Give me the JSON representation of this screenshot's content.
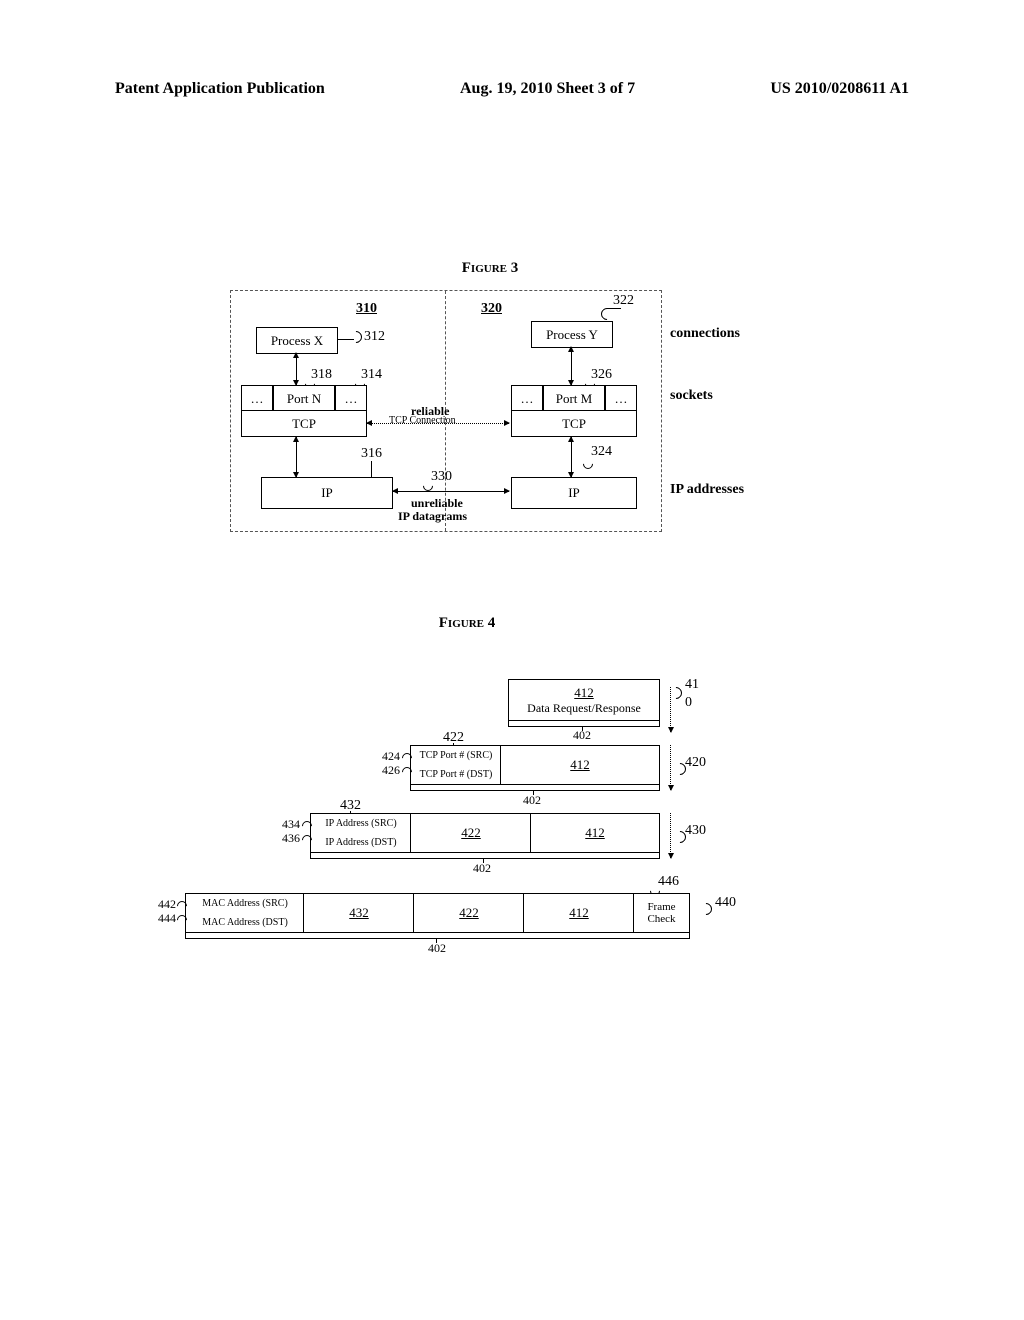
{
  "header": {
    "left": "Patent Application Publication",
    "center": "Aug. 19, 2010   Sheet 3 of 7",
    "right": "US 2010/0208611 A1"
  },
  "fig3": {
    "title": "Figure 3",
    "colA_ref": "310",
    "colB_ref": "320",
    "proc_x": "Process X",
    "proc_y": "Process Y",
    "ref_312": "312",
    "ref_322": "322",
    "ref_318": "318",
    "ref_314": "314",
    "ref_326": "326",
    "ref_316": "316",
    "ref_324": "324",
    "ref_330": "330",
    "portN": "Port N",
    "portM": "Port M",
    "dots": "…",
    "tcp": "TCP",
    "ip": "IP",
    "reliable": "reliable",
    "tcpconn": "TCP Connection",
    "unreliable": "unreliable",
    "ipdg": "IP datagrams",
    "side_conn": "connections",
    "side_sock": "sockets",
    "side_ip": "IP addresses"
  },
  "fig4": {
    "title": "Figure 4",
    "ref_402": "402",
    "ref_412": "412",
    "data_req": "Data Request/Response",
    "ref_410a": "41",
    "ref_410b": "0",
    "ref_420": "420",
    "ref_422": "422",
    "ref_424": "424",
    "ref_426": "426",
    "tcp_src": "TCP Port # (SRC)",
    "tcp_dst": "TCP Port # (DST)",
    "ref_430": "430",
    "ref_432": "432",
    "ref_434": "434",
    "ref_436": "436",
    "ip_src": "IP  Address (SRC)",
    "ip_dst": "IP Address (DST)",
    "ref_440": "440",
    "ref_442": "442",
    "ref_444": "444",
    "ref_446": "446",
    "mac_src": "MAC  Address (SRC)",
    "mac_dst": "MAC Address (DST)",
    "frame_check": "Frame\nCheck"
  }
}
